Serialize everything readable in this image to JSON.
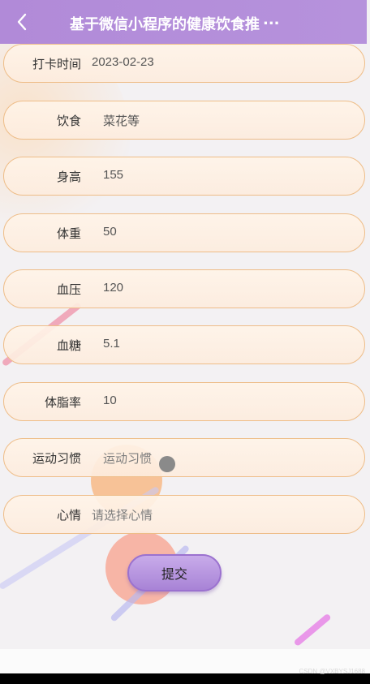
{
  "header": {
    "title": "基于微信小程序的健康饮食推",
    "ellipsis": "...",
    "back_icon": "chevron-left-icon"
  },
  "form": {
    "fields": [
      {
        "label": "打卡时间",
        "value": "2023-02-23",
        "placeholder": false
      },
      {
        "label": "饮食",
        "value": "菜花等",
        "placeholder": false
      },
      {
        "label": "身高",
        "value": "155",
        "placeholder": false
      },
      {
        "label": "体重",
        "value": "50",
        "placeholder": false
      },
      {
        "label": "血压",
        "value": "120",
        "placeholder": false
      },
      {
        "label": "血糖",
        "value": "5.1",
        "placeholder": false
      },
      {
        "label": "体脂率",
        "value": "10",
        "placeholder": false
      },
      {
        "label": "运动习惯",
        "value": "运动习惯",
        "placeholder": true
      },
      {
        "label": "心情",
        "value": "请选择心情",
        "placeholder": true
      }
    ],
    "submit_label": "提交"
  },
  "footer": {
    "watermark": "CSDN @VXBYSJ1688"
  },
  "colors": {
    "header_bg": "#b18ad8",
    "field_border": "#eebd88",
    "button_bg": "#b896e0"
  }
}
